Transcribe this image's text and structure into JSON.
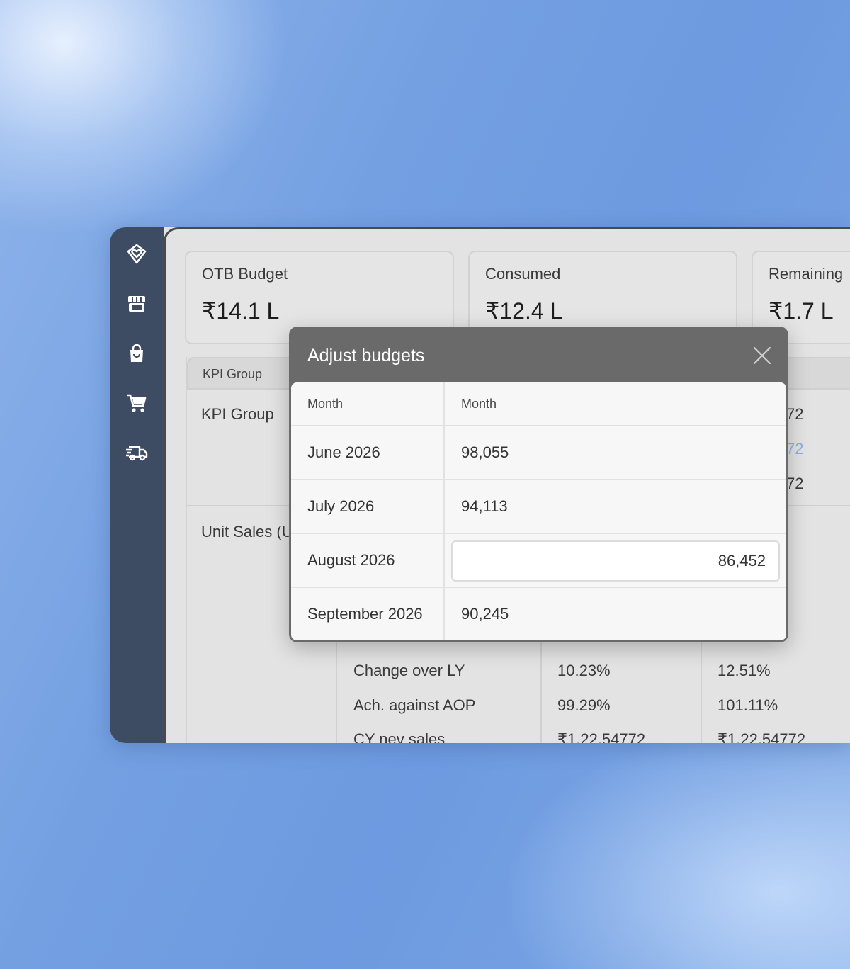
{
  "sidebar": {
    "items": [
      {
        "icon": "logo-heart-icon"
      },
      {
        "icon": "store-icon"
      },
      {
        "icon": "shopping-bag-icon"
      },
      {
        "icon": "cart-icon"
      },
      {
        "icon": "delivery-truck-icon"
      }
    ]
  },
  "summary": {
    "otb_budget": {
      "label": "OTB Budget",
      "value": "₹14.1 L"
    },
    "consumed": {
      "label": "Consumed",
      "value": "₹12.4 L"
    },
    "remaining": {
      "label": "Remaining",
      "value": "₹1.7 L"
    }
  },
  "table": {
    "header": "KPI Group",
    "row_group_1": "KPI Group",
    "partial_values": [
      "72",
      "72",
      "72"
    ],
    "row_group_2": "Unit Sales (U",
    "rows": [
      {
        "metric": "Change over LY",
        "col1": "10.23%",
        "col2": "12.51%"
      },
      {
        "metric": "Ach. against AOP",
        "col1": "99.29%",
        "col2": "101.11%"
      },
      {
        "metric": "CY nev sales",
        "col1": "₹1,22,54772",
        "col2": "₹1,22,54772"
      }
    ]
  },
  "modal": {
    "title": "Adjust budgets",
    "columns": [
      "Month",
      "Month"
    ],
    "rows": [
      {
        "month": "June 2026",
        "value": "98,055"
      },
      {
        "month": "July 2026",
        "value": "94,113"
      },
      {
        "month": "August 2026",
        "value": "86,452"
      },
      {
        "month": "September 2026",
        "value": "90,245"
      }
    ]
  },
  "colors": {
    "sidebar": "#3d4b63",
    "modal_header": "#6a6a6a",
    "link_blue": "#8eaee8"
  }
}
